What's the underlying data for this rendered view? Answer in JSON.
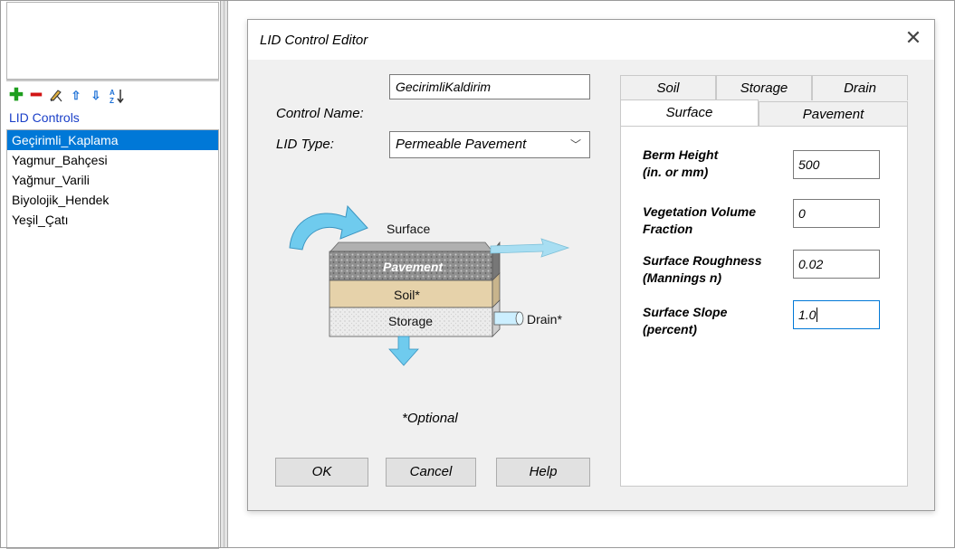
{
  "sidebar": {
    "section_title": "LID Controls",
    "items": [
      {
        "label": "Geçirimli_Kaplama",
        "selected": true
      },
      {
        "label": "Yagmur_Bahçesi",
        "selected": false
      },
      {
        "label": "Yağmur_Varili",
        "selected": false
      },
      {
        "label": "Biyolojik_Hendek",
        "selected": false
      },
      {
        "label": "Yeşil_Çatı",
        "selected": false
      }
    ],
    "toolbar_icons": [
      "add-icon",
      "delete-icon",
      "edit-icon",
      "move-up-icon",
      "move-down-icon",
      "sort-az-icon"
    ]
  },
  "dialog": {
    "title": "LID Control Editor",
    "control_name_label": "Control Name:",
    "control_name_value": "GecirimliKaldirim",
    "lid_type_label": "LID Type:",
    "lid_type_value": "Permeable Pavement",
    "diagram": {
      "surface": "Surface",
      "pavement": "Pavement",
      "soil": "Soil*",
      "storage": "Storage",
      "drain": "Drain*"
    },
    "optional_note": "*Optional",
    "buttons": {
      "ok": "OK",
      "cancel": "Cancel",
      "help": "Help"
    }
  },
  "tabs": {
    "row1": [
      "Soil",
      "Storage",
      "Drain"
    ],
    "row2": [
      "Surface",
      "Pavement"
    ],
    "active": "Surface"
  },
  "surface": {
    "params": [
      {
        "label_line1": "Berm Height",
        "label_line2": "(in. or mm)",
        "value": "500"
      },
      {
        "label_line1": "Vegetation Volume",
        "label_line2": "Fraction",
        "value": "0"
      },
      {
        "label_line1": "Surface Roughness",
        "label_line2": "(Mannings n)",
        "value": "0.02"
      },
      {
        "label_line1": "Surface Slope",
        "label_line2": "(percent)",
        "value": "1.0"
      }
    ]
  },
  "colors": {
    "selection": "#0078d7",
    "section_title": "#1a3fc8",
    "arrow": "#5bc0e6",
    "soil": "#e4d0a8",
    "pavement": "#8a8a8a",
    "storage": "#e8e8e8"
  }
}
